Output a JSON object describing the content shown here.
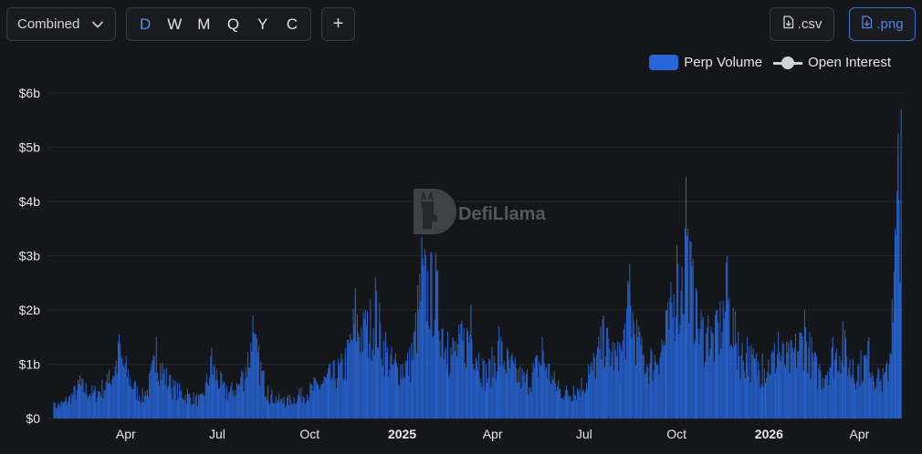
{
  "toolbar": {
    "aggregation_label": "Combined",
    "periods": [
      "D",
      "W",
      "M",
      "Q",
      "Y",
      "C"
    ],
    "active_period": "D",
    "add_label": "+",
    "csv_label": ".csv",
    "png_label": ".png"
  },
  "watermark": {
    "text": "DefiLlama"
  },
  "colors": {
    "background": "#151619",
    "bar": "#2766d8",
    "accent": "#4f86e8",
    "grid": "#24262b",
    "line": "#d0d2d8"
  },
  "icons": {
    "select": "chevron-down-icon",
    "add": "plus-icon",
    "download": "file-download-icon",
    "watermark": "llama-logo-icon"
  },
  "chart_data": {
    "type": "bar",
    "title": "",
    "xlabel": "",
    "ylabel": "",
    "ylim": [
      0,
      6
    ],
    "y_ticks": [
      0,
      1,
      2,
      3,
      4,
      5,
      6
    ],
    "y_tick_labels": [
      "$0",
      "$1b",
      "$2b",
      "$3b",
      "$4b",
      "$5b",
      "$6b"
    ],
    "x_range": [
      "2024-01-15",
      "2026-05-16"
    ],
    "x_ticks": [
      {
        "date": "2024-04-01",
        "label": "Apr",
        "bold": false
      },
      {
        "date": "2024-07-01",
        "label": "Jul",
        "bold": false
      },
      {
        "date": "2024-10-01",
        "label": "Oct",
        "bold": false
      },
      {
        "date": "2025-01-01",
        "label": "2025",
        "bold": true
      },
      {
        "date": "2025-04-01",
        "label": "Apr",
        "bold": false
      },
      {
        "date": "2025-07-01",
        "label": "Jul",
        "bold": false
      },
      {
        "date": "2025-10-01",
        "label": "Oct",
        "bold": false
      },
      {
        "date": "2026-01-01",
        "label": "2026",
        "bold": true
      },
      {
        "date": "2026-04-01",
        "label": "Apr",
        "bold": false
      }
    ],
    "grid": true,
    "legend_position": "top-right",
    "series": [
      {
        "name": "Perp Volume",
        "kind": "bar",
        "color": "#2766d8",
        "points": [
          [
            "2024-01-20",
            0.3
          ],
          [
            "2024-02-01",
            0.4
          ],
          [
            "2024-02-15",
            0.8
          ],
          [
            "2024-03-01",
            0.6
          ],
          [
            "2024-03-15",
            0.9
          ],
          [
            "2024-03-25",
            1.55
          ],
          [
            "2024-04-10",
            0.7
          ],
          [
            "2024-04-20",
            0.5
          ],
          [
            "2024-05-01",
            1.5
          ],
          [
            "2024-05-15",
            0.8
          ],
          [
            "2024-06-01",
            0.55
          ],
          [
            "2024-06-15",
            0.45
          ],
          [
            "2024-06-25",
            1.3
          ],
          [
            "2024-07-10",
            0.6
          ],
          [
            "2024-07-25",
            0.9
          ],
          [
            "2024-08-05",
            1.9
          ],
          [
            "2024-08-20",
            0.6
          ],
          [
            "2024-09-05",
            0.4
          ],
          [
            "2024-09-20",
            0.55
          ],
          [
            "2024-10-05",
            0.75
          ],
          [
            "2024-10-20",
            1.0
          ],
          [
            "2024-11-05",
            1.3
          ],
          [
            "2024-11-15",
            2.4
          ],
          [
            "2024-11-25",
            2.0
          ],
          [
            "2024-12-05",
            2.6
          ],
          [
            "2024-12-15",
            1.6
          ],
          [
            "2024-12-25",
            1.2
          ],
          [
            "2025-01-10",
            1.4
          ],
          [
            "2025-01-20",
            3.35
          ],
          [
            "2025-02-03",
            3.05
          ],
          [
            "2025-02-15",
            1.6
          ],
          [
            "2025-03-01",
            1.8
          ],
          [
            "2025-03-10",
            2.1
          ],
          [
            "2025-03-25",
            1.0
          ],
          [
            "2025-04-07",
            1.7
          ],
          [
            "2025-04-20",
            1.2
          ],
          [
            "2025-05-05",
            0.9
          ],
          [
            "2025-05-20",
            1.5
          ],
          [
            "2025-06-05",
            0.7
          ],
          [
            "2025-06-20",
            0.6
          ],
          [
            "2025-07-05",
            1.0
          ],
          [
            "2025-07-20",
            1.9
          ],
          [
            "2025-08-05",
            1.4
          ],
          [
            "2025-08-15",
            2.85
          ],
          [
            "2025-08-25",
            1.6
          ],
          [
            "2025-09-05",
            1.3
          ],
          [
            "2025-09-20",
            2.0
          ],
          [
            "2025-10-01",
            3.2
          ],
          [
            "2025-10-06",
            2.8
          ],
          [
            "2025-10-10",
            4.45
          ],
          [
            "2025-10-20",
            2.4
          ],
          [
            "2025-11-01",
            1.9
          ],
          [
            "2025-11-10",
            2.0
          ],
          [
            "2025-11-20",
            3.0
          ],
          [
            "2025-12-01",
            1.6
          ],
          [
            "2025-12-10",
            1.5
          ],
          [
            "2025-12-25",
            1.2
          ],
          [
            "2026-01-10",
            1.6
          ],
          [
            "2026-01-20",
            1.4
          ],
          [
            "2026-02-05",
            2.0
          ],
          [
            "2026-02-20",
            1.0
          ],
          [
            "2026-03-05",
            1.5
          ],
          [
            "2026-03-15",
            1.8
          ],
          [
            "2026-03-25",
            1.1
          ],
          [
            "2026-04-10",
            1.5
          ],
          [
            "2026-04-20",
            0.9
          ],
          [
            "2026-04-28",
            1.05
          ],
          [
            "2026-05-03",
            2.2
          ],
          [
            "2026-05-06",
            3.5
          ],
          [
            "2026-05-09",
            5.25
          ],
          [
            "2026-05-12",
            5.7
          ]
        ]
      },
      {
        "name": "Open Interest",
        "kind": "line",
        "color": "#d0d2d8",
        "points": []
      }
    ]
  }
}
